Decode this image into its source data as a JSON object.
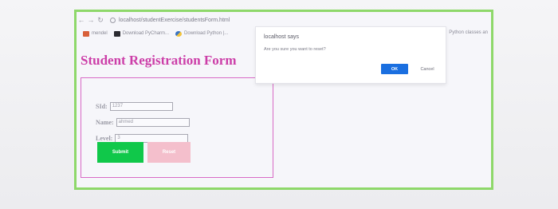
{
  "browser": {
    "url": "localhost/studentExercise/studentsForm.html",
    "bookmarks": [
      {
        "label": "mendel",
        "icon": "gmail-icon"
      },
      {
        "label": "Download PyCharm...",
        "icon": "pycharm-icon"
      },
      {
        "label": "Download Python |...",
        "icon": "python-icon"
      }
    ],
    "bookmarks_right": "Python classes an"
  },
  "page": {
    "title": "Student Registration Form"
  },
  "form": {
    "sid_label": "SId:",
    "sid_value": "1237",
    "name_label": "Name:",
    "name_value": "ahmed",
    "level_label": "Level:",
    "level_value": "3",
    "submit_label": "Submit",
    "reset_label": "Reset"
  },
  "dialog": {
    "title": "localhost says",
    "message": "Are you sure you want to reset?",
    "ok_label": "OK",
    "cancel_label": "Cancel"
  },
  "colors": {
    "title": "#cc3ea8",
    "submit": "#10c84a",
    "reset": "#f4bfcc",
    "ok": "#1a6fe0",
    "screen_border": "#8ed86a"
  }
}
